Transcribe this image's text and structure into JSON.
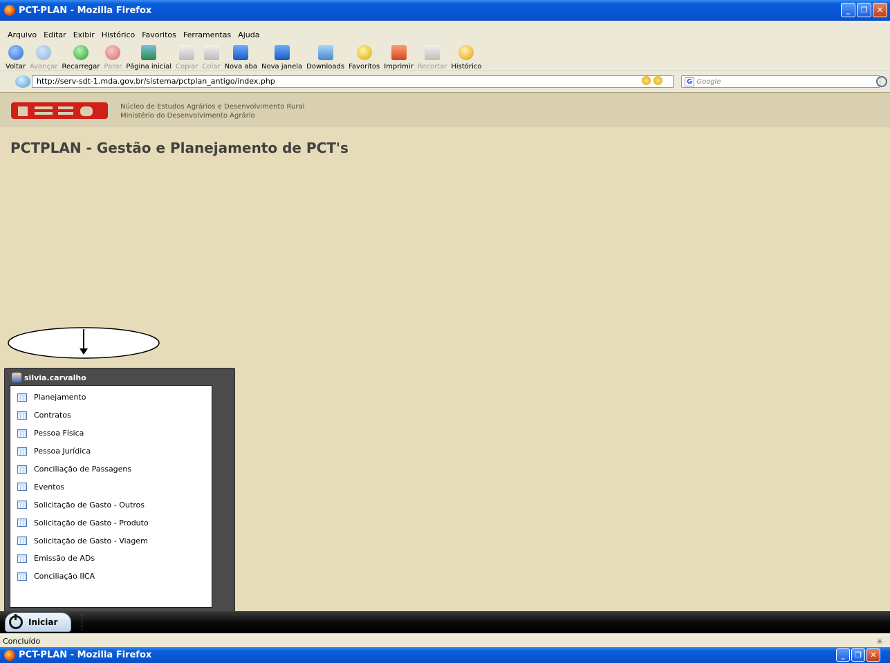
{
  "window": {
    "title": "PCT-PLAN - Mozilla Firefox",
    "minimize": "_",
    "maximize": "❐",
    "close": "✕"
  },
  "menubar": {
    "items": [
      "Arquivo",
      "Editar",
      "Exibir",
      "Histórico",
      "Favoritos",
      "Ferramentas",
      "Ajuda"
    ]
  },
  "toolbar": {
    "back": "Voltar",
    "forward": "Avançar",
    "reload": "Recarregar",
    "stop": "Parar",
    "home": "Página inicial",
    "copy": "Copiar",
    "paste": "Colar",
    "new_tab": "Nova aba",
    "new_window": "Nova janela",
    "downloads": "Downloads",
    "bookmarks": "Favoritos",
    "print": "Imprimir",
    "cut": "Recortar",
    "history": "Histórico"
  },
  "address": {
    "url": "http://serv-sdt-1.mda.gov.br/sistema/pctplan_antigo/index.php",
    "search_placeholder": "Google",
    "search_engine": "G"
  },
  "page": {
    "org_line1": "Núcleo de Estudos Agrários e Desenvolvimento Rural",
    "org_line2": "Ministério do Desenvolvimento Agrário",
    "title": "PCTPLAN - Gestão e Planejamento de PCT's",
    "colors": {
      "background": "#e6dcb9",
      "header_band": "#d8d0b0",
      "logo_red": "#d0201a"
    }
  },
  "startmenu": {
    "user": "silvia.carvalho",
    "items": [
      "Planejamento",
      "Contratos",
      "Pessoa Física",
      "Pessoa Jurídica",
      "Conciliação de Passagens",
      "Eventos",
      "Solicitação de Gasto - Outros",
      "Solicitação de Gasto - Produto",
      "Solicitação de Gasto - Viagem",
      "Emissão de ADs",
      "Conciliação IICA"
    ]
  },
  "taskbar": {
    "start_label": "Iniciar"
  },
  "status": {
    "text": "Concluído"
  }
}
